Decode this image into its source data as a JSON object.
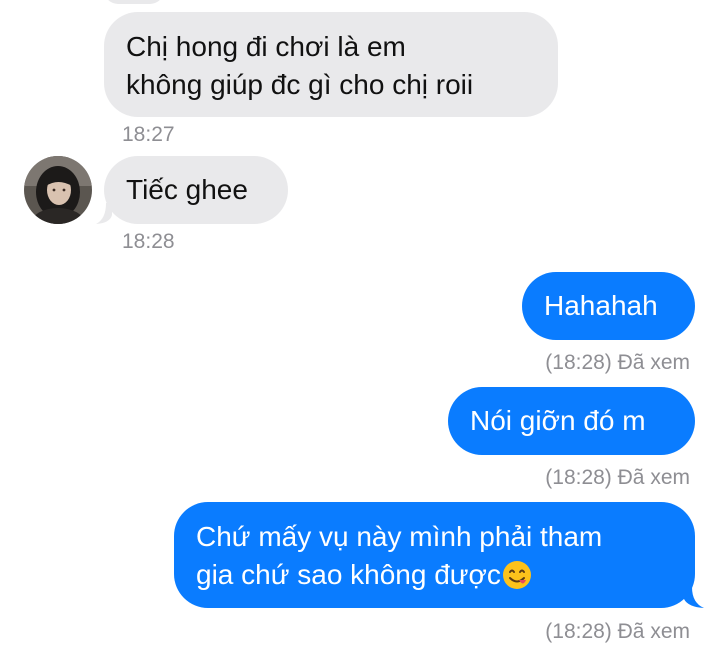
{
  "messages": [
    {
      "id": "m1",
      "direction": "incoming",
      "lines": [
        "Chị hong đi chơi là em",
        "không giúp đc gì cho chị roii"
      ],
      "time": "18:27"
    },
    {
      "id": "m2",
      "direction": "incoming",
      "lines": [
        "Tiếc ghee"
      ],
      "time": "18:28",
      "show_avatar": true
    },
    {
      "id": "m3",
      "direction": "outgoing",
      "lines": [
        "Hahahah"
      ],
      "time": "(18:28) Đã xem"
    },
    {
      "id": "m4",
      "direction": "outgoing",
      "lines": [
        "Nói giỡn đó m"
      ],
      "time": "(18:28) Đã xem"
    },
    {
      "id": "m5",
      "direction": "outgoing",
      "lines": [
        "Chứ mấy vụ này mình phải tham",
        "gia chứ sao không được"
      ],
      "emoji": "😋",
      "emoji_name": "yum-face-emoji",
      "time": "(18:28) Đã xem"
    }
  ],
  "colors": {
    "incoming_bubble": "#e9e9eb",
    "outgoing_bubble": "#0a7cff",
    "timestamp": "#8e8e93"
  },
  "icons": {
    "avatar": "contact-avatar-photo"
  }
}
